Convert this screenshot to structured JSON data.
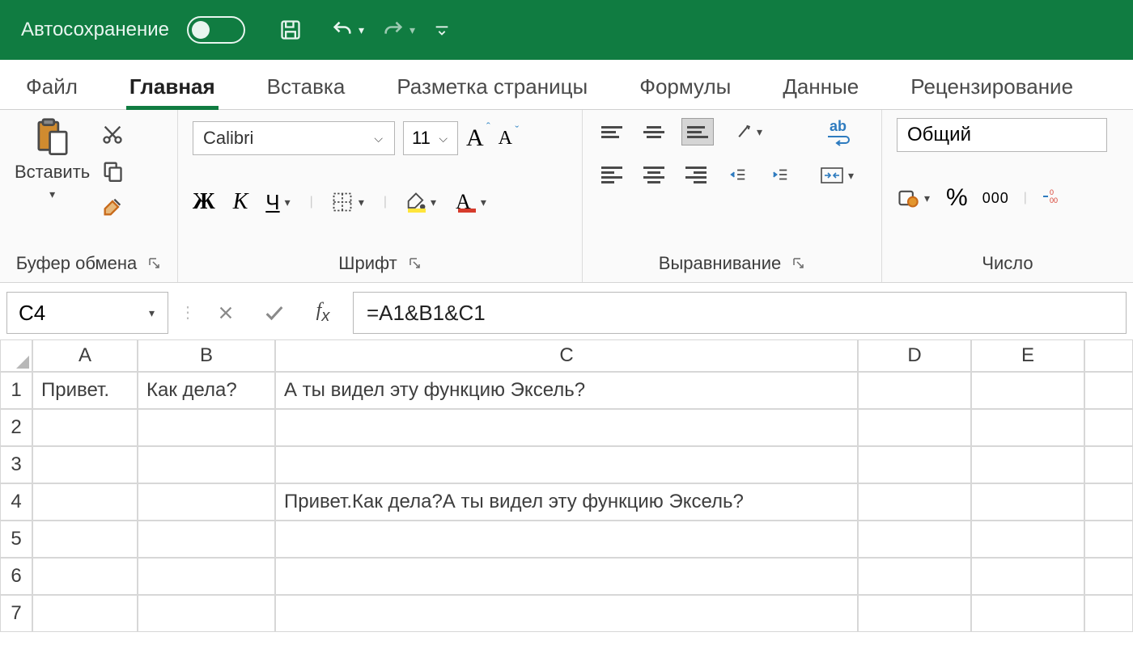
{
  "titlebar": {
    "autosave": "Автосохранение"
  },
  "ribbon_tabs": [
    "Файл",
    "Главная",
    "Вставка",
    "Разметка страницы",
    "Формулы",
    "Данные",
    "Рецензирование"
  ],
  "active_tab_index": 1,
  "clipboard": {
    "paste": "Вставить",
    "group_name": "Буфер обмена"
  },
  "font": {
    "name": "Calibri",
    "size": "11",
    "bold_glyph": "Ж",
    "italic_glyph": "К",
    "underline_glyph": "Ч",
    "font_color_glyph": "А",
    "group_name": "Шрифт"
  },
  "alignment": {
    "wrap_glyph": "ab",
    "group_name": "Выравнивание"
  },
  "number": {
    "format": "Общий",
    "percent_glyph": "%",
    "thousands_glyph": "000",
    "group_name": "Число"
  },
  "formula_bar": {
    "cell_ref": "C4",
    "formula": "=A1&B1&C1"
  },
  "grid": {
    "col_headers": [
      "A",
      "B",
      "C",
      "D",
      "E",
      ""
    ],
    "row_headers": [
      "1",
      "2",
      "3",
      "4",
      "5",
      "6",
      "7"
    ],
    "cells": {
      "A1": "Привет.",
      "B1": "Как  дела?",
      "C1": "А ты видел эту функцию Эксель?",
      "C4": "Привет.Как  дела?А ты видел эту функцию Эксель?"
    }
  }
}
